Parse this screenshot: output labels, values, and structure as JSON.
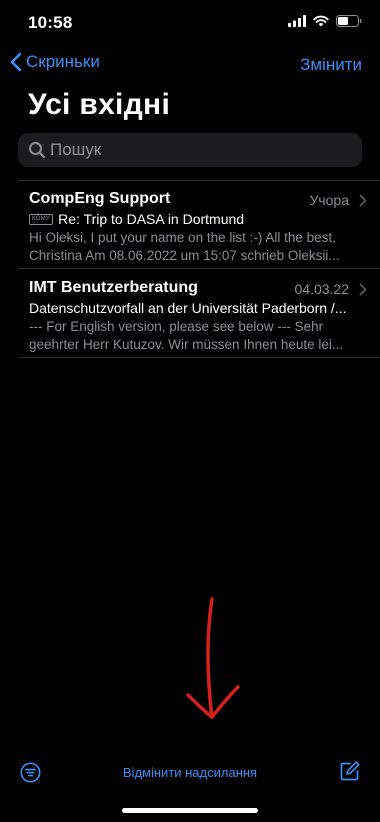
{
  "status_bar": {
    "time": "10:58"
  },
  "nav": {
    "back_label": "Скриньки",
    "edit_label": "Змінити"
  },
  "title": "Усі вхідні",
  "search": {
    "placeholder": "Пошук",
    "value": ""
  },
  "mails": [
    {
      "sender": "CompEng Support",
      "date": "Учора",
      "to_badge": "КОМУ",
      "subject": "Re: Trip to DASA in Dortmund",
      "preview_line1": "Hi Oleksi, I put your name on the list :-) All the best,",
      "preview_line2": "Christina Am 08.06.2022 um 15:07 schrieb Oleksii..."
    },
    {
      "sender": "IMT Benutzerberatung",
      "date": "04.03.22",
      "subject": "Datenschutzvorfall an der Universität Paderborn /...",
      "preview_line1": "--- For English version, please see below --- Sehr",
      "preview_line2": "geehrter Herr Kutuzov. Wir müssen Ihnen heute lei..."
    }
  ],
  "toolbar": {
    "undo_send_label": "Відмінити надсилання"
  },
  "colors": {
    "accent": "#3a8ef6",
    "background": "#000000",
    "secondary_text": "#8d8d93",
    "annotation_arrow": "#d61f1f"
  },
  "icons": {
    "status": [
      "cellular-signal-icon",
      "wifi-icon",
      "battery-icon"
    ],
    "nav": "chevron-left-icon",
    "search": "search-icon",
    "row": "chevron-right-icon",
    "toolbar": [
      "filter-icon",
      "compose-icon"
    ]
  }
}
